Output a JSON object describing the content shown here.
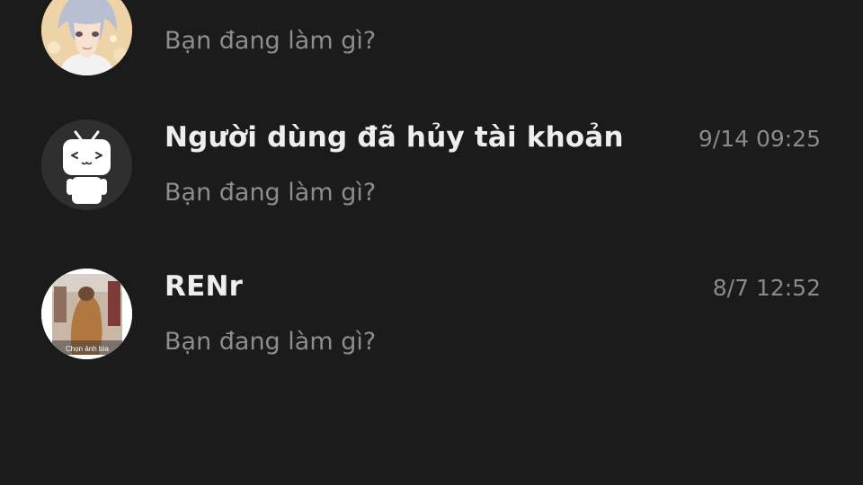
{
  "conversations": [
    {
      "name": "",
      "preview": "Bạn đang làm gì?",
      "time": "",
      "avatar": "anime-boy-avatar"
    },
    {
      "name": "Người dùng đã hủy tài khoản",
      "preview": "Bạn đang làm gì?",
      "time": "9/14 09:25",
      "avatar": "bilibili-tv-mascot-avatar"
    },
    {
      "name": "RENr",
      "preview": "Bạn đang làm gì?",
      "time": "8/7 12:52",
      "avatar": "photo-avatar",
      "avatar_caption": "Chọn ảnh bìa"
    }
  ],
  "colors": {
    "background": "#1b1b1b",
    "name": "#eeeeee",
    "preview": "#8d8d8d",
    "time": "#8a8a8a",
    "default_avatar_bg": "#2f2f2f"
  }
}
